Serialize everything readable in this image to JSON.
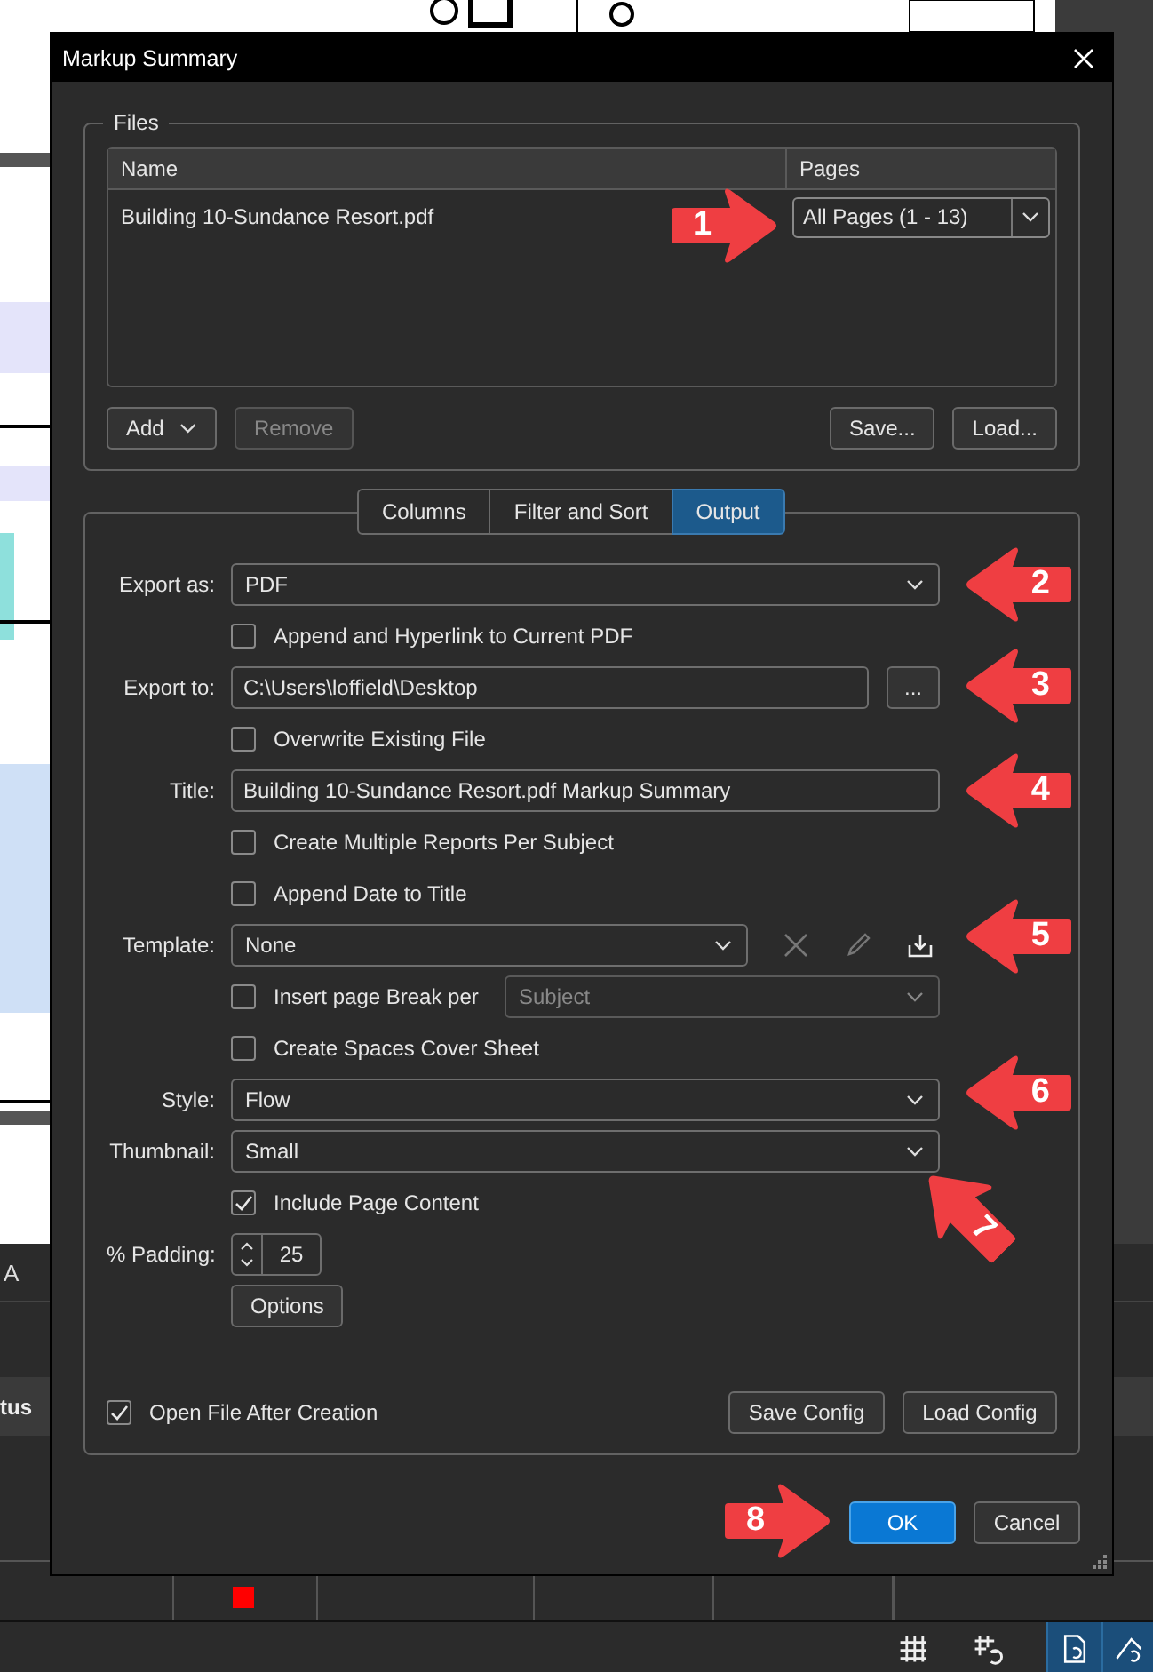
{
  "background": {
    "panel_text": "A",
    "column_header": "tus"
  },
  "dialog": {
    "title": "Markup Summary",
    "files": {
      "legend": "Files",
      "columns": [
        "Name",
        "Pages"
      ],
      "rows": [
        {
          "name": "Building 10-Sundance Resort.pdf",
          "pages": "All Pages (1 - 13)"
        }
      ],
      "buttons": [
        {
          "label": "Add",
          "kind": "menu",
          "disabled": false
        },
        {
          "label": "Remove",
          "kind": "plain",
          "disabled": true
        },
        {
          "label": "Save...",
          "kind": "plain",
          "disabled": false
        },
        {
          "label": "Load...",
          "kind": "plain",
          "disabled": false
        }
      ]
    },
    "tabs": [
      {
        "label": "Columns",
        "selected": false
      },
      {
        "label": "Filter and Sort",
        "selected": false
      },
      {
        "label": "Output",
        "selected": true
      }
    ],
    "output_rows": [
      {
        "kind": "select",
        "label": "Export as:",
        "value": "PDF"
      },
      {
        "kind": "checkbox",
        "text": "Append and Hyperlink to Current PDF",
        "checked": false
      },
      {
        "kind": "path",
        "label": "Export to:",
        "value": "C:\\Users\\loffield\\Desktop",
        "button": "..."
      },
      {
        "kind": "checkbox",
        "text": "Overwrite Existing File",
        "checked": false
      },
      {
        "kind": "input",
        "label": "Title:",
        "value": "Building 10-Sundance Resort.pdf Markup Summary"
      },
      {
        "kind": "checkbox",
        "text": "Create Multiple Reports Per Subject",
        "checked": false
      },
      {
        "kind": "checkbox",
        "text": "Append Date to Title",
        "checked": false
      },
      {
        "kind": "template",
        "label": "Template:",
        "value": "None"
      },
      {
        "kind": "checkbox_select",
        "text": "Insert page Break per",
        "checked": false,
        "value": "Subject",
        "disabled": true
      },
      {
        "kind": "checkbox",
        "text": "Create Spaces Cover Sheet",
        "checked": false
      },
      {
        "kind": "select",
        "label": "Style:",
        "value": "Flow"
      },
      {
        "kind": "select",
        "label": "Thumbnail:",
        "value": "Small"
      },
      {
        "kind": "checkbox",
        "text": "Include Page Content",
        "checked": true
      },
      {
        "kind": "spinner",
        "label": "% Padding:",
        "value": "25"
      },
      {
        "kind": "button",
        "label": "Options"
      }
    ],
    "open_after": {
      "text": "Open File After Creation",
      "checked": true
    },
    "config_buttons": [
      "Save Config",
      "Load Config"
    ],
    "footer_buttons": [
      {
        "label": "OK",
        "kind": "primary"
      },
      {
        "label": "Cancel",
        "kind": "plain"
      }
    ]
  },
  "callouts": [
    {
      "number": "1",
      "kind": "right"
    },
    {
      "number": "2",
      "kind": "left"
    },
    {
      "number": "3",
      "kind": "left"
    },
    {
      "number": "4",
      "kind": "left"
    },
    {
      "number": "5",
      "kind": "left"
    },
    {
      "number": "6",
      "kind": "left"
    },
    {
      "number": "7",
      "kind": "up_left"
    },
    {
      "number": "8",
      "kind": "right"
    }
  ]
}
